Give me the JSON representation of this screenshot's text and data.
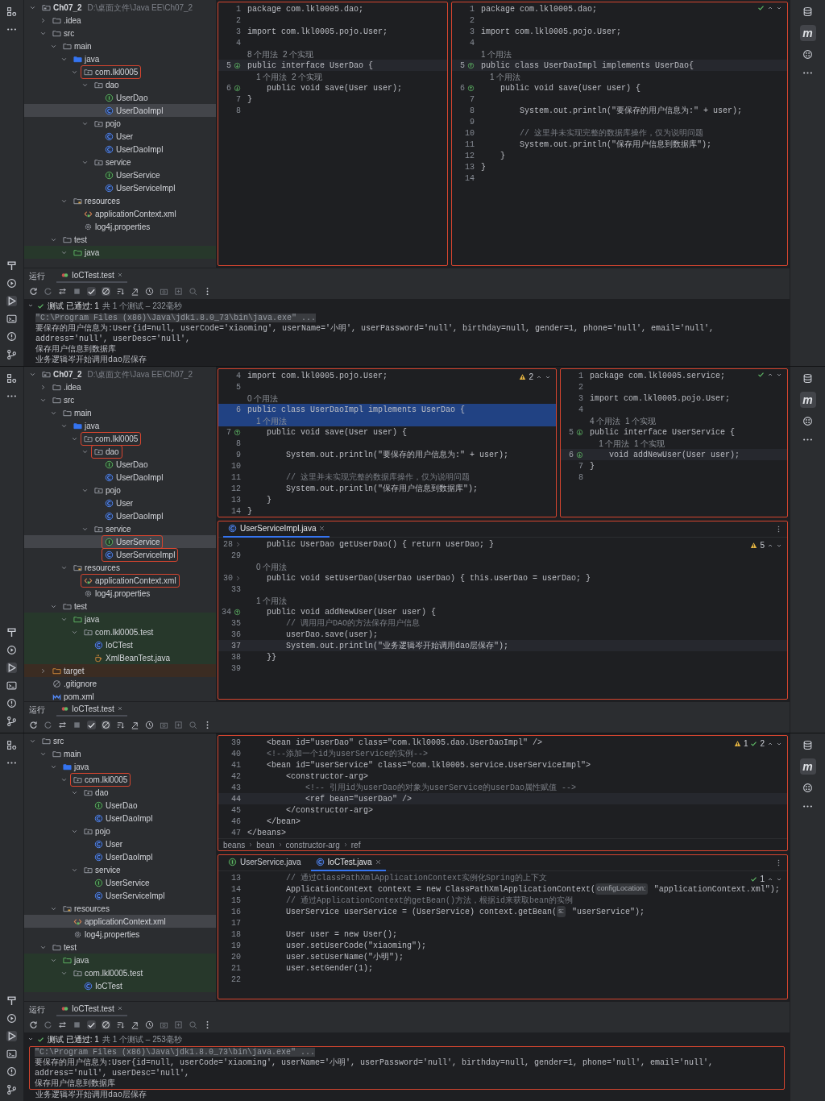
{
  "panels": [
    {
      "tree": [
        {
          "label": "Ch07_2",
          "path": "D:\\桌面文件\\Java EE\\Ch07_2",
          "kind": "project",
          "expanded": true,
          "children": [
            {
              "label": ".idea",
              "kind": "folder",
              "expanded": false
            },
            {
              "label": "src",
              "kind": "folder",
              "expanded": true,
              "children": [
                {
                  "label": "main",
                  "kind": "folder",
                  "expanded": true,
                  "children": [
                    {
                      "label": "java",
                      "kind": "source",
                      "expanded": true,
                      "children": [
                        {
                          "label": "com.lkl0005",
                          "kind": "package",
                          "expanded": true,
                          "boxed": true,
                          "children": [
                            {
                              "label": "dao",
                              "kind": "package",
                              "expanded": true,
                              "children": [
                                {
                                  "label": "UserDao",
                                  "kind": "interface"
                                },
                                {
                                  "label": "UserDaoImpl",
                                  "kind": "class",
                                  "selected": true
                                }
                              ]
                            },
                            {
                              "label": "pojo",
                              "kind": "package",
                              "expanded": true,
                              "children": [
                                {
                                  "label": "User",
                                  "kind": "class"
                                },
                                {
                                  "label": "UserDaoImpl",
                                  "kind": "class"
                                }
                              ]
                            },
                            {
                              "label": "service",
                              "kind": "package",
                              "expanded": true,
                              "children": [
                                {
                                  "label": "UserService",
                                  "kind": "interface"
                                },
                                {
                                  "label": "UserServiceImpl",
                                  "kind": "class"
                                }
                              ]
                            }
                          ]
                        }
                      ]
                    },
                    {
                      "label": "resources",
                      "kind": "resources",
                      "expanded": true,
                      "children": [
                        {
                          "label": "applicationContext.xml",
                          "kind": "xml"
                        },
                        {
                          "label": "log4j.properties",
                          "kind": "properties"
                        }
                      ]
                    }
                  ]
                },
                {
                  "label": "test",
                  "kind": "folder",
                  "expanded": true,
                  "children": [
                    {
                      "label": "java",
                      "kind": "test-source",
                      "expanded": true,
                      "in_test": true
                    }
                  ]
                }
              ]
            }
          ]
        }
      ],
      "editor_rows": [
        [
          {
            "boxed": true,
            "lines": [
              {
                "num": "1",
                "code": "package com.lkl0005.dao;"
              },
              {
                "num": "2"
              },
              {
                "num": "3",
                "code": "import com.lkl0005.pojo.User;"
              },
              {
                "num": "4"
              },
              {
                "kind": "hint",
                "code": "8 个用法  2 个实现"
              },
              {
                "num": "5",
                "code": "public interface UserDao {",
                "current": true,
                "implemented": true
              },
              {
                "kind": "hint",
                "code": "    1 个用法  2 个实现"
              },
              {
                "num": "6",
                "code": "    public void save(User user);",
                "implemented": true
              },
              {
                "num": "7",
                "code": "}"
              },
              {
                "num": "8"
              }
            ]
          },
          {
            "boxed": true,
            "inspections": [
              {
                "kind": "ok"
              }
            ],
            "lines": [
              {
                "num": "1",
                "code": "package com.lkl0005.dao;"
              },
              {
                "num": "2"
              },
              {
                "num": "3",
                "code": "import com.lkl0005.pojo.User;"
              },
              {
                "num": "4"
              },
              {
                "kind": "hint",
                "code": "1 个用法"
              },
              {
                "num": "5",
                "code": "public class UserDaoImpl implements UserDao{",
                "current": true,
                "implementing": true
              },
              {
                "kind": "hint",
                "code": "    1 个用法"
              },
              {
                "num": "6",
                "code": "    public void save(User user) {",
                "implementing": true
              },
              {
                "num": "7"
              },
              {
                "num": "8",
                "code": "        System.out.println(\"要保存的用户信息为:\" + user);"
              },
              {
                "num": "9"
              },
              {
                "num": "10",
                "code": "        // 这里并未实现完整的数据库操作，仅为说明问题",
                "kind": "comment"
              },
              {
                "num": "11",
                "code": "        System.out.println(\"保存用户信息到数据库\");"
              },
              {
                "num": "12",
                "code": "    }"
              },
              {
                "num": "13",
                "code": "}"
              },
              {
                "num": "14"
              }
            ]
          }
        ]
      ],
      "run": {
        "title": "运行",
        "tab": "IoCTest.test",
        "result": {
          "status": "测试 已通过: 1",
          "summary": "共 1 个测试 – 232毫秒"
        },
        "console": [
          {
            "kind": "command",
            "text": "\"C:\\Program Files (x86)\\Java\\jdk1.8.0_73\\bin\\java.exe\" ..."
          },
          {
            "kind": "output",
            "text": "要保存的用户信息为:User{id=null, userCode='xiaoming', userName='小明', userPassword='null', birthday=null, gender=1, phone='null', email='null', address='null', userDesc='null',"
          },
          {
            "kind": "output",
            "text": "保存用户信息到数据库"
          },
          {
            "kind": "output",
            "text": "业务逻辑岑开始调用dao层保存"
          }
        ]
      },
      "right_logo": "m"
    },
    {
      "tree": [
        {
          "label": "Ch07_2",
          "path": "D:\\桌面文件\\Java EE\\Ch07_2",
          "kind": "project",
          "expanded": true,
          "children": [
            {
              "label": ".idea",
              "kind": "folder",
              "expanded": false
            },
            {
              "label": "src",
              "kind": "folder",
              "expanded": true,
              "children": [
                {
                  "label": "main",
                  "kind": "folder",
                  "expanded": true,
                  "children": [
                    {
                      "label": "java",
                      "kind": "source",
                      "expanded": true,
                      "children": [
                        {
                          "label": "com.lkl0005",
                          "kind": "package",
                          "expanded": true,
                          "boxed": true,
                          "children": [
                            {
                              "label": "dao",
                              "kind": "package",
                              "expanded": true,
                              "boxed": true,
                              "children": [
                                {
                                  "label": "UserDao",
                                  "kind": "interface"
                                },
                                {
                                  "label": "UserDaoImpl",
                                  "kind": "class"
                                }
                              ]
                            },
                            {
                              "label": "pojo",
                              "kind": "package",
                              "expanded": true,
                              "children": [
                                {
                                  "label": "User",
                                  "kind": "class"
                                },
                                {
                                  "label": "UserDaoImpl",
                                  "kind": "class"
                                }
                              ]
                            },
                            {
                              "label": "service",
                              "kind": "package",
                              "expanded": true,
                              "children": [
                                {
                                  "label": "UserService",
                                  "kind": "interface",
                                  "selected": true,
                                  "boxed": true
                                },
                                {
                                  "label": "UserServiceImpl",
                                  "kind": "class",
                                  "boxed": true
                                }
                              ]
                            }
                          ]
                        }
                      ]
                    },
                    {
                      "label": "resources",
                      "kind": "resources",
                      "expanded": true,
                      "children": [
                        {
                          "label": "applicationContext.xml",
                          "kind": "xml",
                          "boxed": true
                        },
                        {
                          "label": "log4j.properties",
                          "kind": "properties"
                        }
                      ]
                    }
                  ]
                },
                {
                  "label": "test",
                  "kind": "folder",
                  "expanded": true,
                  "children": [
                    {
                      "label": "java",
                      "kind": "test-source",
                      "expanded": true,
                      "in_test": true,
                      "children": [
                        {
                          "label": "com.lkl0005.test",
                          "kind": "package",
                          "expanded": true,
                          "in_test": true,
                          "children": [
                            {
                              "label": "IoCTest",
                              "kind": "class",
                              "in_test": true
                            },
                            {
                              "label": "XmlBeanTest.java",
                              "kind": "javafile",
                              "in_test": true
                            }
                          ]
                        }
                      ]
                    }
                  ]
                }
              ]
            },
            {
              "label": "target",
              "kind": "excluded",
              "expanded": false,
              "excluded": true
            },
            {
              "label": ".gitignore",
              "kind": "gitignore"
            },
            {
              "label": "pom.xml",
              "kind": "pom"
            }
          ]
        }
      ],
      "editor_rows": [
        [
          {
            "boxed": true,
            "inspections": [
              {
                "kind": "warning",
                "count": "2"
              }
            ],
            "lines": [
              {
                "num": "4",
                "code": "import com.lkl0005.pojo.User;"
              },
              {
                "num": "5"
              },
              {
                "kind": "hint",
                "code": "0 个用法"
              },
              {
                "num": "6",
                "code": "public class UserDaoImpl implements UserDao {",
                "selected": true
              },
              {
                "kind": "hint",
                "code": "    1 个用法",
                "selected": true
              },
              {
                "num": "7",
                "code": "    public void save(User user) {",
                "implementing": true
              },
              {
                "num": "8"
              },
              {
                "num": "9",
                "code": "        System.out.println(\"要保存的用户信息为:\" + user);"
              },
              {
                "num": "10"
              },
              {
                "num": "11",
                "code": "        // 这里并未实现完整的数据库操作，仅为说明问题",
                "kind": "comment"
              },
              {
                "num": "12",
                "code": "        System.out.println(\"保存用户信息到数据库\");"
              },
              {
                "num": "13",
                "code": "    }"
              },
              {
                "num": "14",
                "code": "}"
              }
            ]
          },
          {
            "boxed": true,
            "inspections": [
              {
                "kind": "ok"
              }
            ],
            "lines": [
              {
                "num": "1",
                "code": "package com.lkl0005.service;"
              },
              {
                "num": "2"
              },
              {
                "num": "3",
                "code": "import com.lkl0005.pojo.User;"
              },
              {
                "num": "4"
              },
              {
                "kind": "hint",
                "code": "4 个用法  1 个实现"
              },
              {
                "num": "5",
                "code": "public interface UserService {",
                "implemented": true
              },
              {
                "kind": "hint",
                "code": "    1 个用法  1 个实现"
              },
              {
                "num": "6",
                "code": "    void addNewUser(User user);",
                "current": true,
                "implemented": true
              },
              {
                "num": "7",
                "code": "}"
              },
              {
                "num": "8"
              }
            ]
          }
        ],
        [
          {
            "boxed": true,
            "tabs": [
              {
                "label": "UserServiceImpl.java",
                "kind": "class",
                "selected": true,
                "closable": true
              }
            ],
            "inspections": [
              {
                "kind": "warning",
                "count": "5"
              }
            ],
            "lines": [
              {
                "num": "28",
                "code": "    public UserDao getUserDao() { return userDao; }",
                "folded": true
              },
              {
                "num": "29"
              },
              {
                "kind": "hint",
                "code": "    0 个用法"
              },
              {
                "num": "30",
                "code": "    public void setUserDao(UserDao userDao) { this.userDao = userDao; }",
                "folded": true
              },
              {
                "num": "33"
              },
              {
                "kind": "hint",
                "code": "    1 个用法"
              },
              {
                "num": "34",
                "code": "    public void addNewUser(User user) {",
                "implementing": true
              },
              {
                "num": "35",
                "code": "        // 调用用户DAO的方法保存用户信息",
                "kind": "comment"
              },
              {
                "num": "36",
                "code": "        userDao.save(user);"
              },
              {
                "num": "37",
                "code": "        System.out.println(\"业务逻辑岑开始调用dao层保存\");",
                "current": true
              },
              {
                "num": "38",
                "code": "    }}"
              },
              {
                "num": "39"
              }
            ]
          }
        ]
      ],
      "run": {
        "title": "运行",
        "tab": "IoCTest.test"
      },
      "right_logo": "m"
    },
    {
      "tree": [
        {
          "label": "src",
          "kind": "folder",
          "expanded": true,
          "children": [
            {
              "label": "main",
              "kind": "folder",
              "expanded": true,
              "children": [
                {
                  "label": "java",
                  "kind": "source",
                  "expanded": true,
                  "children": [
                    {
                      "label": "com.lkl0005",
                      "kind": "package",
                      "expanded": true,
                      "boxed": true,
                      "children": [
                        {
                          "label": "dao",
                          "kind": "package",
                          "expanded": true,
                          "children": [
                            {
                              "label": "UserDao",
                              "kind": "interface"
                            },
                            {
                              "label": "UserDaoImpl",
                              "kind": "class"
                            }
                          ]
                        },
                        {
                          "label": "pojo",
                          "kind": "package",
                          "expanded": true,
                          "children": [
                            {
                              "label": "User",
                              "kind": "class"
                            },
                            {
                              "label": "UserDaoImpl",
                              "kind": "class"
                            }
                          ]
                        },
                        {
                          "label": "service",
                          "kind": "package",
                          "expanded": true,
                          "children": [
                            {
                              "label": "UserService",
                              "kind": "interface"
                            },
                            {
                              "label": "UserServiceImpl",
                              "kind": "class"
                            }
                          ]
                        }
                      ]
                    }
                  ]
                },
                {
                  "label": "resources",
                  "kind": "resources",
                  "expanded": true,
                  "children": [
                    {
                      "label": "applicationContext.xml",
                      "kind": "xml",
                      "selected": true
                    },
                    {
                      "label": "log4j.properties",
                      "kind": "properties"
                    }
                  ]
                }
              ]
            },
            {
              "label": "test",
              "kind": "folder",
              "expanded": true,
              "children": [
                {
                  "label": "java",
                  "kind": "test-source",
                  "expanded": true,
                  "in_test": true,
                  "children": [
                    {
                      "label": "com.lkl0005.test",
                      "kind": "package",
                      "expanded": true,
                      "in_test": true,
                      "children": [
                        {
                          "label": "IoCTest",
                          "kind": "class",
                          "in_test": true
                        }
                      ]
                    }
                  ]
                }
              ]
            }
          ]
        }
      ],
      "editor_rows": [
        [
          {
            "boxed": true,
            "inspections": [
              {
                "kind": "warning",
                "count": "1"
              },
              {
                "kind": "ok",
                "count": "2"
              }
            ],
            "breadcrumb": [
              "beans",
              "bean",
              "constructor-arg",
              "ref"
            ],
            "lines": [
              {
                "num": "39",
                "code": "    <bean id=\"userDao\" class=\"com.lkl0005.dao.UserDaoImpl\" />"
              },
              {
                "num": "40",
                "code": "    <!--添加一个id为userService的实例-->",
                "kind": "comment"
              },
              {
                "num": "41",
                "code": "    <bean id=\"userService\" class=\"com.lkl0005.service.UserServiceImpl\">"
              },
              {
                "num": "42",
                "code": "        <constructor-arg>"
              },
              {
                "num": "43",
                "code": "            <!-- 引用id为userDao的对象为userService的userDao属性赋值 -->",
                "kind": "comment"
              },
              {
                "num": "44",
                "code": "            <ref bean=\"userDao\" />",
                "current": true
              },
              {
                "num": "45",
                "code": "        </constructor-arg>"
              },
              {
                "num": "46",
                "code": "    </bean>"
              },
              {
                "num": "47",
                "code": "</beans>"
              }
            ]
          }
        ],
        [
          {
            "boxed": true,
            "tabs": [
              {
                "label": "UserService.java",
                "kind": "interface",
                "selected": false,
                "closable": false
              },
              {
                "label": "IoCTest.java",
                "kind": "class",
                "selected": true,
                "closable": true
              }
            ],
            "inspections": [
              {
                "kind": "ok",
                "count": "1"
              }
            ],
            "lines": [
              {
                "num": "13",
                "code": "        // 通过ClassPathXmlApplicationContext实例化Spring的上下文",
                "kind": "comment"
              },
              {
                "num": "14",
                "parts": [
                  {
                    "kind": "code",
                    "text": "        ApplicationContext context = new ClassPathXmlApplicationContext("
                  },
                  {
                    "kind": "inlay",
                    "text": "configLocation:"
                  },
                  {
                    "kind": "code",
                    "text": " \"applicationContext.xml\");"
                  }
                ]
              },
              {
                "num": "15",
                "code": "        // 通过ApplicationContext的getBean()方法，根据id来获取bean的实例",
                "kind": "comment"
              },
              {
                "num": "16",
                "parts": [
                  {
                    "kind": "code",
                    "text": "        UserService userService = (UserService) context.getBean("
                  },
                  {
                    "kind": "inlay",
                    "text": "s:"
                  },
                  {
                    "kind": "code",
                    "text": " \"userService\");"
                  }
                ]
              },
              {
                "num": "17"
              },
              {
                "num": "18",
                "code": "        User user = new User();"
              },
              {
                "num": "19",
                "code": "        user.setUserCode(\"xiaoming\");"
              },
              {
                "num": "20",
                "code": "        user.setUserName(\"小明\");"
              },
              {
                "num": "21",
                "code": "        user.setGender(1);"
              },
              {
                "num": "22"
              }
            ]
          }
        ]
      ],
      "run": {
        "title": "运行",
        "tab": "IoCTest.test",
        "result": {
          "status": "测试 已通过: 1",
          "summary": "共 1 个测试 – 253毫秒"
        },
        "console": [
          {
            "kind": "command",
            "text": "\"C:\\Program Files (x86)\\Java\\jdk1.8.0_73\\bin\\java.exe\" ...",
            "boxed": true
          },
          {
            "kind": "output",
            "text": "要保存的用户信息为:User{id=null, userCode='xiaoming', userName='小明', userPassword='null', birthday=null, gender=1, phone='null', email='null', address='null', userDesc='null',",
            "boxed": true
          },
          {
            "kind": "output",
            "text": "保存用户信息到数据库",
            "boxed": true
          },
          {
            "kind": "output",
            "text": "业务逻辑岑开始调用dao层保存"
          }
        ]
      },
      "right_logo": "m"
    }
  ]
}
